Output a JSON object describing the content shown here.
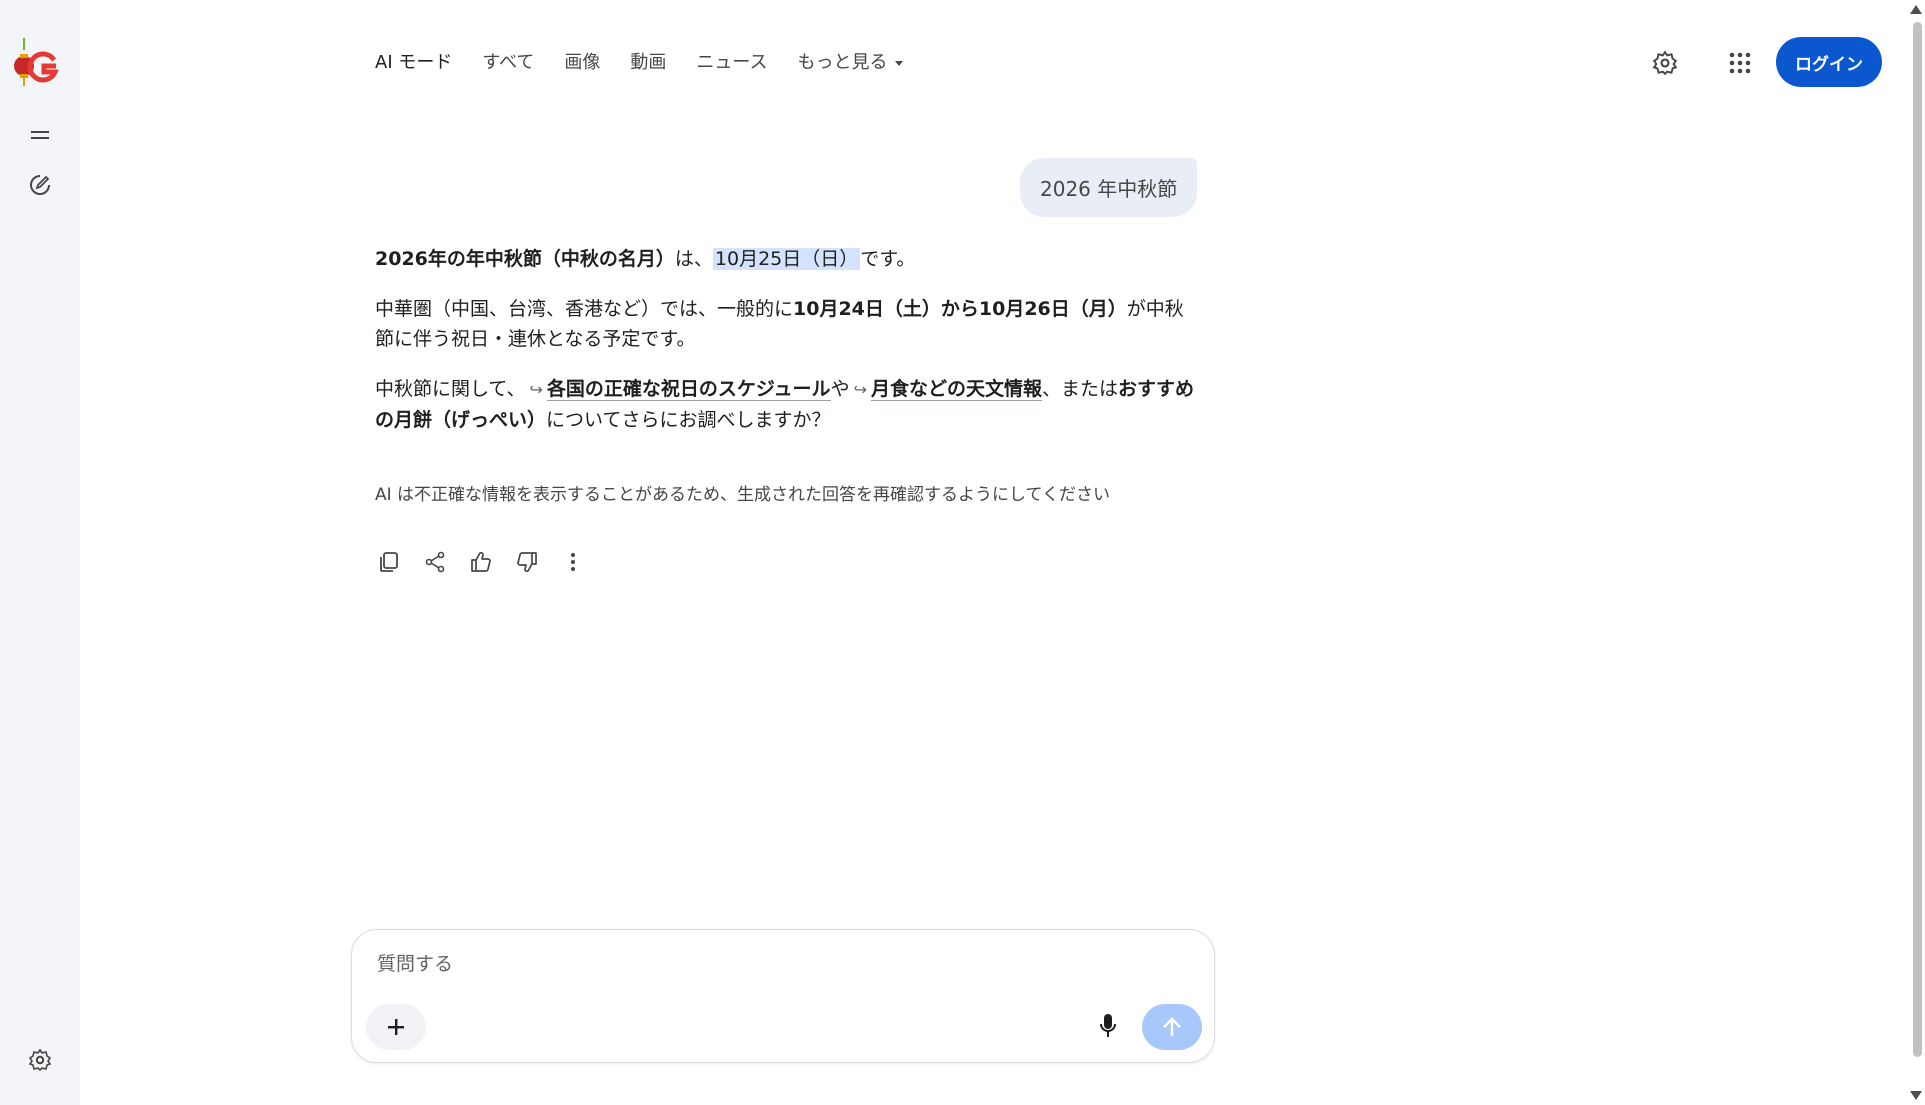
{
  "nav": {
    "tabs": [
      {
        "label": "AI モード"
      },
      {
        "label": "すべて"
      },
      {
        "label": "画像"
      },
      {
        "label": "動画"
      },
      {
        "label": "ニュース"
      },
      {
        "label": "もっと見る"
      }
    ]
  },
  "header": {
    "login_label": "ログイン"
  },
  "conversation": {
    "user_query": "2026 年中秋節",
    "answer": {
      "p1_bold": "2026年の年中秋節（中秋の名月）",
      "p1_mid": "は、",
      "p1_highlight": "10月25日（日）",
      "p1_end": "です。",
      "p2_start": "中華圏（中国、台湾、香港など）では、一般的に",
      "p2_bold": "10月24日（土）から10月26日（月）",
      "p2_end": "が中秋節に伴う祝日・連休となる予定です。",
      "p3_start": "中秋節に関して、",
      "p3_link1": "各国の正確な祝日のスケジュール",
      "p3_mid1": "や",
      "p3_link2": "月食などの天文情報",
      "p3_mid2": "、または",
      "p3_bold": "おすすめの月餅（げっぺい）",
      "p3_end": "についてさらにお調べしますか？",
      "arrow": "↪"
    },
    "disclaimer": "AI は不正確な情報を表示することがあるため、生成された回答を再確認するようにしてください"
  },
  "composer": {
    "placeholder": "質問する"
  },
  "colors": {
    "accent": "#0b57d0",
    "sidebar_bg": "#f3f5f8",
    "bubble_bg": "#e9eef6",
    "highlight": "#d3e3fd",
    "send_disabled": "#a8c7fa"
  }
}
